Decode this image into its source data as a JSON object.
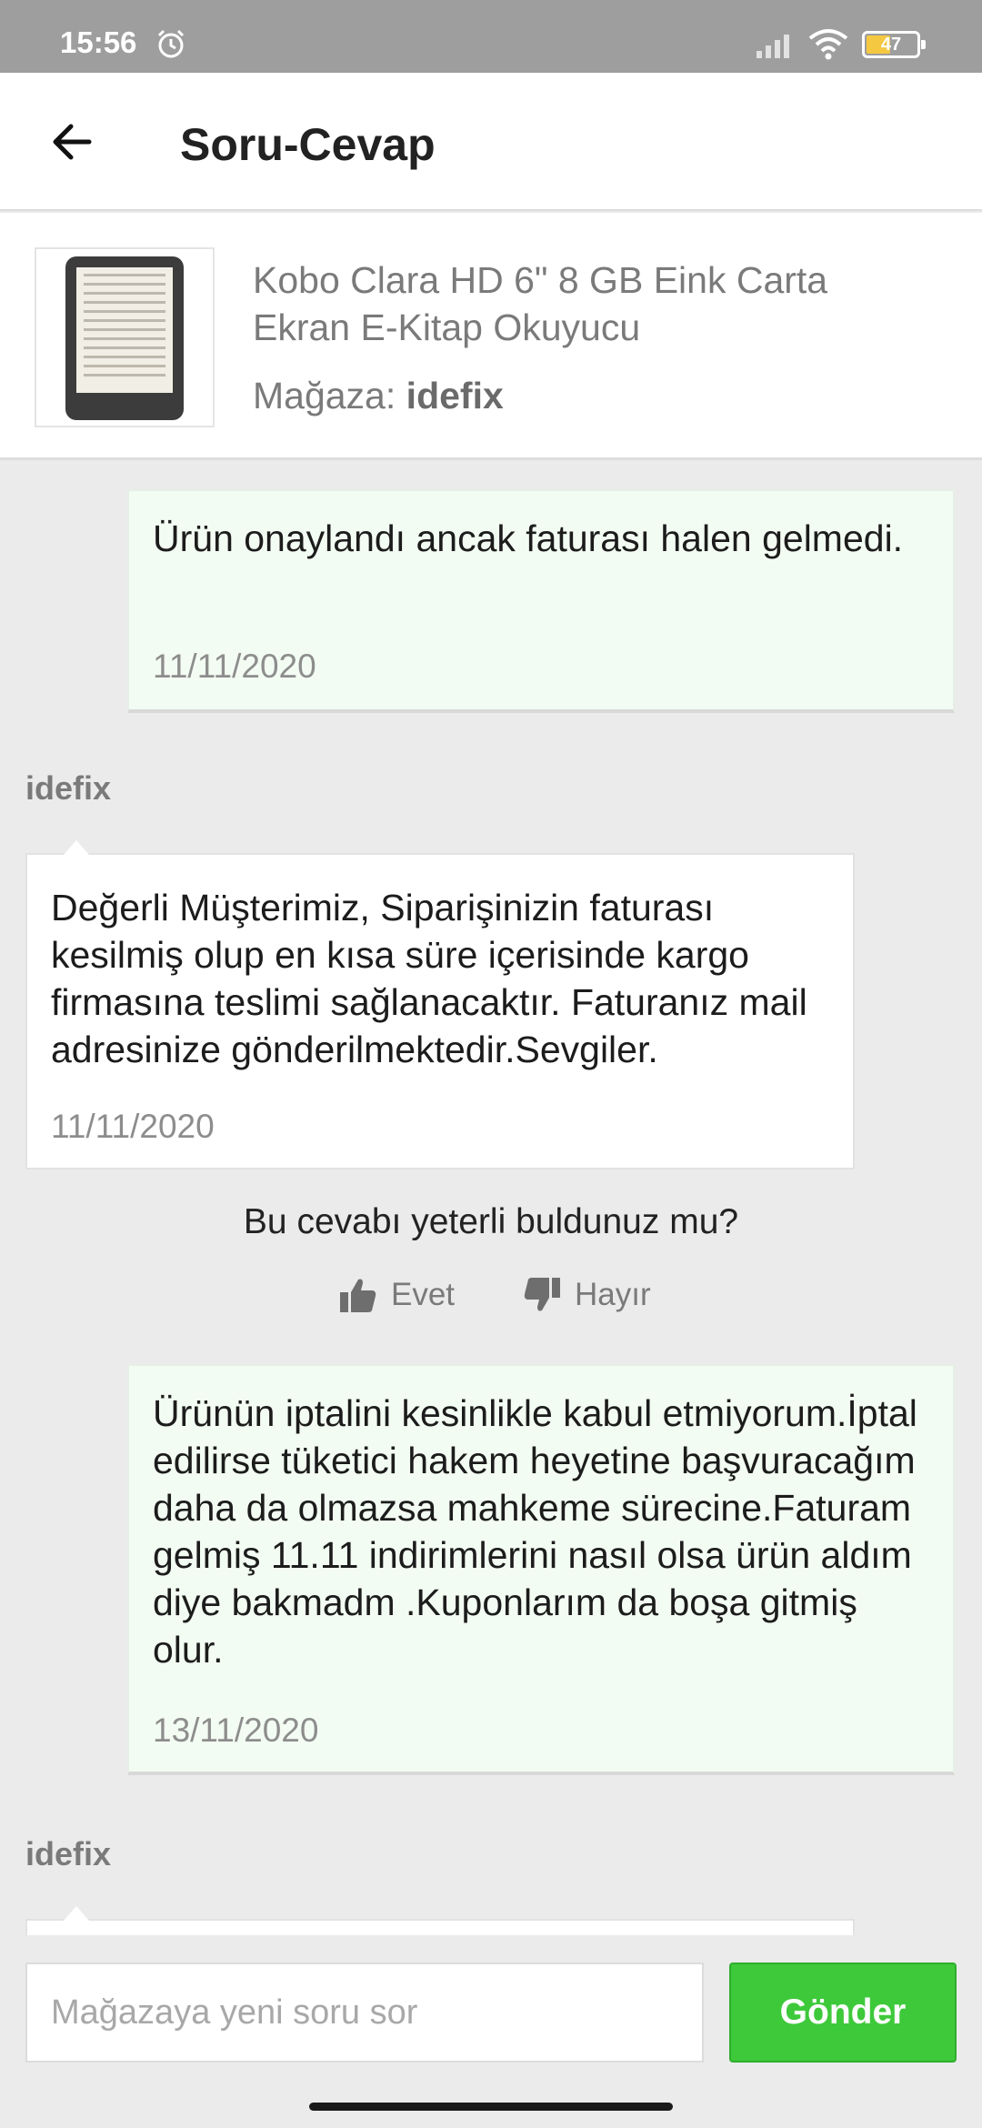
{
  "status_bar": {
    "time": "15:56",
    "battery": "47",
    "icons": [
      "alarm-icon",
      "signal-icon",
      "wifi-icon",
      "battery-icon"
    ]
  },
  "header": {
    "title": "Soru-Cevap",
    "back_icon": "arrow-left-icon"
  },
  "product": {
    "name": "Kobo Clara HD 6\" 8 GB Eink Carta Ekran E-Kitap Okuyucu",
    "store_label": "Mağaza:",
    "store_name": "idefix"
  },
  "thread": [
    {
      "type": "question",
      "text": "Ürün onaylandı ancak faturası halen gelmedi.",
      "date": "11/11/2020"
    },
    {
      "type": "answer",
      "seller": "idefix",
      "text": "Değerli Müşterimiz, Siparişinizin faturası kesilmiş olup en kısa süre içerisinde kargo firmasına teslimi sağlanacaktır. Faturanız mail adresinize gönderilmektedir.Sevgiler.",
      "date": "11/11/2020"
    },
    {
      "type": "question",
      "text": "Ürünün iptalini kesinlikle kabul etmiyorum.İptal edilirse tüketici hakem heyetine başvuracağım daha da olmazsa mahkeme sürecine.Faturam gelmiş 11.11 indirimlerini nasıl olsa ürün aldım diye bakmadm .Kuponlarım da boşa gitmiş olur.",
      "date": "13/11/2020"
    },
    {
      "type": "answer",
      "seller": "idefix"
    }
  ],
  "feedback": {
    "question": "Bu cevabı yeterli buldunuz mu?",
    "yes": "Evet",
    "no": "Hayır"
  },
  "composer": {
    "placeholder": "Mağazaya yeni soru sor",
    "send": "Gönder"
  },
  "colors": {
    "accent": "#3ec93b",
    "question_bg": "#f3fcf3",
    "background": "#ebebeb",
    "status_bar": "#9e9e9e"
  }
}
